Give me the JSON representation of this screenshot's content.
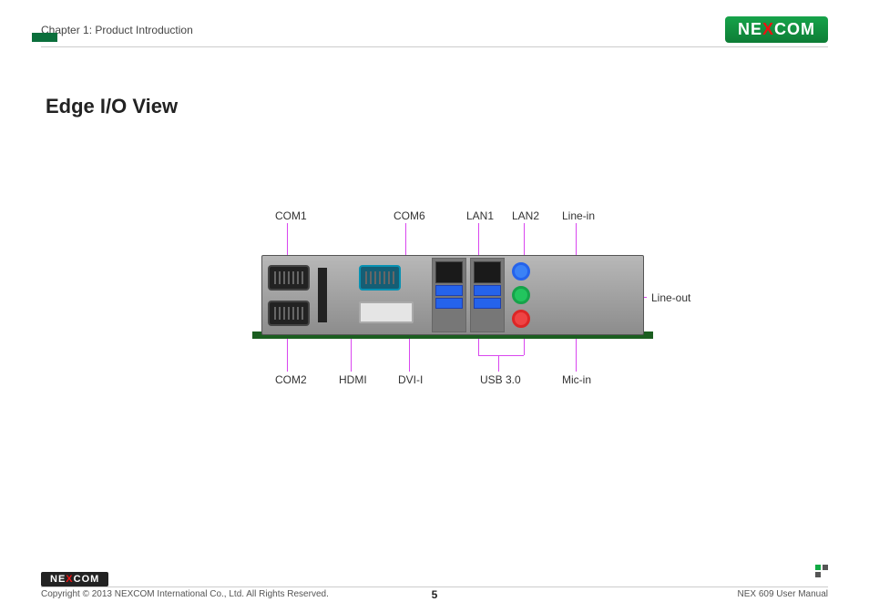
{
  "header": {
    "chapter": "Chapter 1: Product Introduction",
    "logo_text_pre": "NE",
    "logo_text_x": "X",
    "logo_text_post": "COM"
  },
  "section": {
    "title": "Edge I/O View"
  },
  "labels": {
    "top": {
      "com1": "COM1",
      "com6": "COM6",
      "lan1": "LAN1",
      "lan2": "LAN2",
      "linein": "Line-in"
    },
    "right": {
      "lineout": "Line-out"
    },
    "bottom": {
      "com2": "COM2",
      "hdmi": "HDMI",
      "dvii": "DVI-I",
      "usb30": "USB 3.0",
      "micin": "Mic-in"
    }
  },
  "footer": {
    "copyright": "Copyright © 2013 NEXCOM International Co., Ltd. All Rights Reserved.",
    "page": "5",
    "manual": "NEX 609 User Manual"
  }
}
